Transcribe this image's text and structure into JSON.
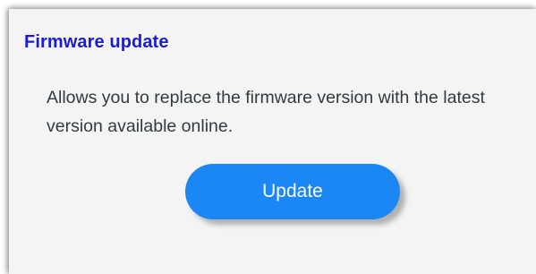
{
  "section": {
    "title": "Firmware update",
    "description": "Allows you to replace the firmware version with the latest version available online.",
    "update_button_label": "Update"
  },
  "colors": {
    "title": "#1b1bd6",
    "button_bg": "#1a87f5",
    "panel_bg": "#f4f4f4"
  }
}
